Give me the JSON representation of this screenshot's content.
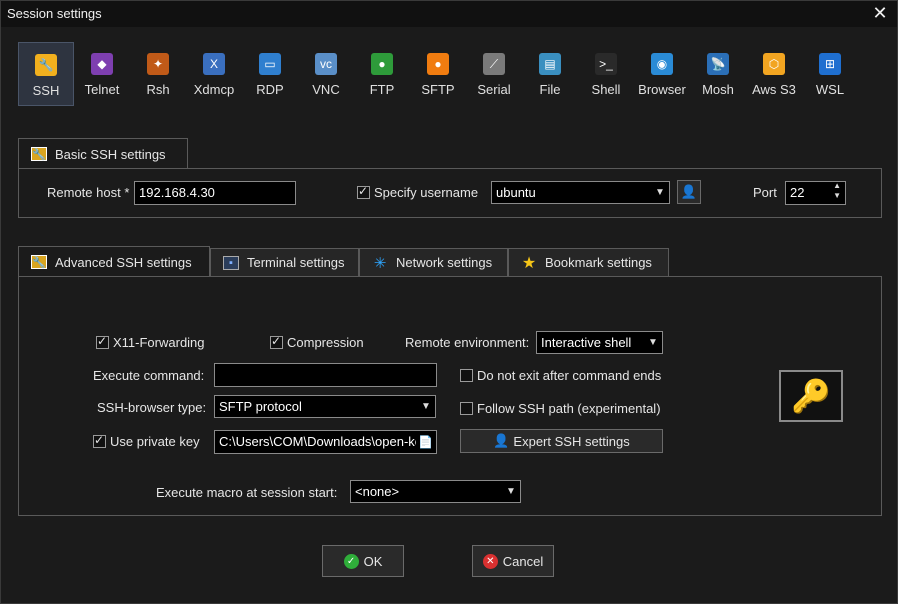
{
  "window": {
    "title": "Session settings",
    "close_glyph": "✕"
  },
  "protocols": [
    {
      "label": "SSH",
      "icon": "ssh-key-icon",
      "color": "#f2b01e",
      "glyph": "🔧"
    },
    {
      "label": "Telnet",
      "icon": "telnet-icon",
      "color": "#7e3fb0",
      "glyph": "◆"
    },
    {
      "label": "Rsh",
      "icon": "rsh-icon",
      "color": "#c05a18",
      "glyph": "✦"
    },
    {
      "label": "Xdmcp",
      "icon": "xdmcp-icon",
      "color": "#3a6fbf",
      "glyph": "X"
    },
    {
      "label": "RDP",
      "icon": "rdp-icon",
      "color": "#2f7fcf",
      "glyph": "▭"
    },
    {
      "label": "VNC",
      "icon": "vnc-icon",
      "color": "#5a8fc8",
      "glyph": "vc"
    },
    {
      "label": "FTP",
      "icon": "ftp-icon",
      "color": "#2e9b3a",
      "glyph": "●"
    },
    {
      "label": "SFTP",
      "icon": "sftp-icon",
      "color": "#f07c10",
      "glyph": "●"
    },
    {
      "label": "Serial",
      "icon": "serial-icon",
      "color": "#7a7a7a",
      "glyph": "⟋"
    },
    {
      "label": "File",
      "icon": "file-icon",
      "color": "#3a8fc0",
      "glyph": "▤"
    },
    {
      "label": "Shell",
      "icon": "shell-icon",
      "color": "#2a2a2a",
      "glyph": ">_"
    },
    {
      "label": "Browser",
      "icon": "browser-icon",
      "color": "#2a8bd6",
      "glyph": "◉"
    },
    {
      "label": "Mosh",
      "icon": "mosh-icon",
      "color": "#2b6fb7",
      "glyph": "📡"
    },
    {
      "label": "Aws S3",
      "icon": "aws-s3-icon",
      "color": "#f2a521",
      "glyph": "⬡"
    },
    {
      "label": "WSL",
      "icon": "wsl-icon",
      "color": "#1f6fd0",
      "glyph": "⊞"
    }
  ],
  "basic": {
    "tab_label": "Basic SSH settings",
    "remote_host_label": "Remote host *",
    "remote_host_value": "192.168.4.30",
    "specify_username_label": "Specify username",
    "specify_username_checked": true,
    "username_value": "ubuntu",
    "port_label": "Port",
    "port_value": "22"
  },
  "advanced_tabs": [
    {
      "label": "Advanced SSH settings",
      "icon": "wrench-icon"
    },
    {
      "label": "Terminal settings",
      "icon": "terminal-icon"
    },
    {
      "label": "Network settings",
      "icon": "network-icon"
    },
    {
      "label": "Bookmark settings",
      "icon": "star-icon"
    }
  ],
  "advanced": {
    "x11_label": "X11-Forwarding",
    "x11_checked": true,
    "compression_label": "Compression",
    "compression_checked": true,
    "remote_env_label": "Remote environment:",
    "remote_env_value": "Interactive shell",
    "execute_command_label": "Execute command:",
    "execute_command_value": "",
    "do_not_exit_label": "Do not exit after command ends",
    "do_not_exit_checked": false,
    "ssh_browser_label": "SSH-browser type:",
    "ssh_browser_value": "SFTP protocol",
    "follow_ssh_label": "Follow SSH path (experimental)",
    "follow_ssh_checked": false,
    "private_key_label": "Use private key",
    "private_key_checked": true,
    "private_key_value": "C:\\Users\\COM\\Downloads\\open-key",
    "expert_button_label": "Expert SSH settings",
    "macro_label": "Execute macro at session start:",
    "macro_value": "<none>"
  },
  "buttons": {
    "ok": "OK",
    "cancel": "Cancel"
  }
}
